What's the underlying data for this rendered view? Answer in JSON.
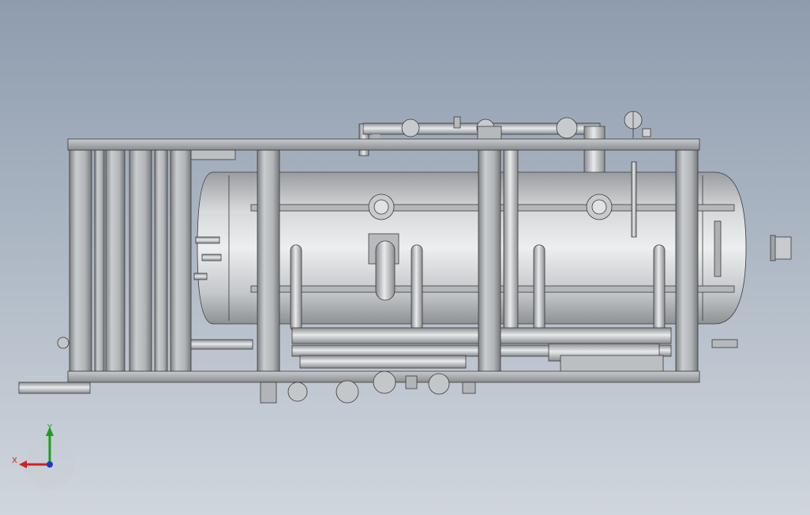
{
  "viewport": {
    "background_top": "#8e9cae",
    "background_bottom": "#d0d6dd",
    "metal_light": "#e4e6e8",
    "metal_mid": "#b8bbbe",
    "metal_dark": "#8c8f92",
    "line_color": "#3a3a3a"
  },
  "triad": {
    "x_label": "X",
    "y_label": "Y",
    "x_color": "#d42020",
    "y_color": "#1aa01a",
    "z_color": "#1a3ad0"
  }
}
